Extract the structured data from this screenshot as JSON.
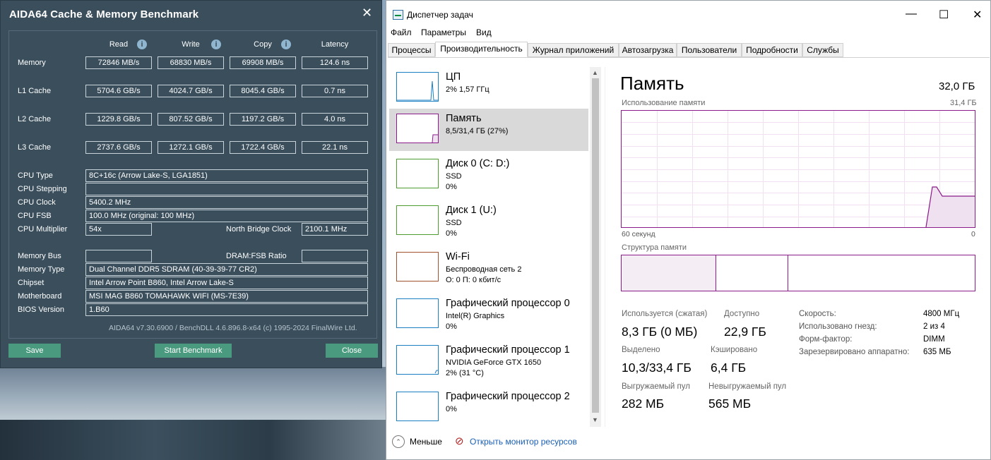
{
  "aida": {
    "title": "AIDA64 Cache & Memory Benchmark",
    "close_glyph": "✕",
    "headers": {
      "read": "Read",
      "write": "Write",
      "copy": "Copy",
      "latency": "Latency"
    },
    "info_glyph": "i",
    "rows": [
      {
        "label": "Memory",
        "read": "72846 MB/s",
        "write": "68830 MB/s",
        "copy": "69908 MB/s",
        "latency": "124.6 ns"
      },
      {
        "label": "L1 Cache",
        "read": "5704.6 GB/s",
        "write": "4024.7 GB/s",
        "copy": "8045.4 GB/s",
        "latency": "0.7 ns"
      },
      {
        "label": "L2 Cache",
        "read": "1229.8 GB/s",
        "write": "807.52 GB/s",
        "copy": "1197.2 GB/s",
        "latency": "4.0 ns"
      },
      {
        "label": "L3 Cache",
        "read": "2737.6 GB/s",
        "write": "1272.1 GB/s",
        "copy": "1722.4 GB/s",
        "latency": "22.1 ns"
      }
    ],
    "cpu_type_label": "CPU Type",
    "cpu_type": "8C+16c   (Arrow Lake-S, LGA1851)",
    "cpu_stepping_label": "CPU Stepping",
    "cpu_stepping": "",
    "cpu_clock_label": "CPU Clock",
    "cpu_clock": "5400.2 MHz",
    "cpu_fsb_label": "CPU FSB",
    "cpu_fsb": "100.0 MHz  (original: 100 MHz)",
    "cpu_mult_label": "CPU Multiplier",
    "cpu_mult": "54x",
    "nb_clock_label": "North Bridge Clock",
    "nb_clock": "2100.1 MHz",
    "mem_bus_label": "Memory Bus",
    "mem_bus": "",
    "dram_ratio_label": "DRAM:FSB Ratio",
    "dram_ratio": "",
    "mem_type_label": "Memory Type",
    "mem_type": "Dual Channel DDR5 SDRAM  (40-39-39-77 CR2)",
    "chipset_label": "Chipset",
    "chipset": "Intel Arrow Point B860, Intel Arrow Lake-S",
    "mobo_label": "Motherboard",
    "mobo": "MSI MAG B860 TOMAHAWK WIFI (MS-7E39)",
    "bios_label": "BIOS Version",
    "bios": "1.B60",
    "footer": "AIDA64 v7.30.6900 / BenchDLL 4.6.896.8-x64  (c) 1995-2024 FinalWire Ltd.",
    "btn_save": "Save",
    "btn_start": "Start Benchmark",
    "btn_close": "Close",
    "colors": {
      "bg": "#3a4e5c",
      "button": "#4a9a7f"
    }
  },
  "tm": {
    "title": "Диспетчер задач",
    "win_min": "—",
    "win_max": "☐",
    "win_close": "✕",
    "menu": [
      "Файл",
      "Параметры",
      "Вид"
    ],
    "tabs": [
      "Процессы",
      "Производительность",
      "Журнал приложений",
      "Автозагрузка",
      "Пользователи",
      "Подробности",
      "Службы"
    ],
    "active_tab": "Производительность",
    "sidebar": [
      {
        "name": "ЦП",
        "sub1": "2% 1,57 ГГц",
        "sub2": "",
        "color": "#1a7fc3"
      },
      {
        "name": "Память",
        "sub1": "8,5/31,4 ГБ (27%)",
        "sub2": "",
        "color": "#8b1a8b"
      },
      {
        "name": "Диск 0 (C: D:)",
        "sub1": "SSD",
        "sub2": "0%",
        "color": "#4d9c2f"
      },
      {
        "name": "Диск 1 (U:)",
        "sub1": "SSD",
        "sub2": "0%",
        "color": "#4d9c2f"
      },
      {
        "name": "Wi-Fi",
        "sub1": "Беспроводная сеть 2",
        "sub2": "О: 0 П: 0 кбит/с",
        "color": "#a0522d"
      },
      {
        "name": "Графический процессор 0",
        "sub1": "Intel(R) Graphics",
        "sub2": "0%",
        "color": "#1a7fc3"
      },
      {
        "name": "Графический процессор 1",
        "sub1": "NVIDIA GeForce GTX 1650",
        "sub2": "2%  (31 °C)",
        "color": "#1a7fc3"
      },
      {
        "name": "Графический процессор 2",
        "sub1": "0%",
        "sub2": "",
        "color": "#1a7fc3"
      }
    ],
    "scroll_up": "▲",
    "scroll_down": "▼",
    "memory": {
      "heading": "Память",
      "total": "32,0 ГБ",
      "usage_label": "Использование памяти",
      "usage_max": "31,4 ГБ",
      "time_left": "60 секунд",
      "time_right": "0",
      "struct_label": "Структура памяти",
      "used_label": "Используется (сжатая)",
      "used": "8,3 ГБ (0 МБ)",
      "avail_label": "Доступно",
      "avail": "22,9 ГБ",
      "commit_label": "Выделено",
      "commit": "10,3/33,4 ГБ",
      "cached_label": "Кэшировано",
      "cached": "6,4 ГБ",
      "paged_label": "Выгружаемый пул",
      "paged": "282 МБ",
      "nonpaged_label": "Невыгружаемый пул",
      "nonpaged": "565 МБ",
      "speed_label": "Скорость:",
      "speed": "4800 МГц",
      "slots_label": "Использовано гнезд:",
      "slots": "2 из 4",
      "form_label": "Форм-фактор:",
      "form": "DIMM",
      "reserved_label": "Зарезервировано аппаратно:",
      "reserved": "635 МБ",
      "usage_fraction": 0.27
    },
    "less_glyph": "⌃",
    "less_label": "Меньше",
    "resmon_glyph": "⊘",
    "resmon_label": "Открыть монитор ресурсов"
  }
}
